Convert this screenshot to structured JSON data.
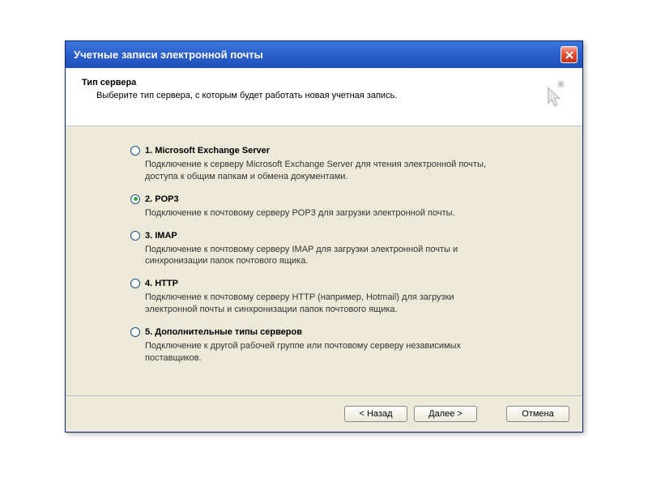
{
  "window": {
    "title": "Учетные записи электронной почты"
  },
  "header": {
    "heading": "Тип сервера",
    "subheading": "Выберите тип сервера, с которым будет работать новая учетная запись."
  },
  "options": [
    {
      "id": "exchange",
      "label": "1. Microsoft Exchange Server",
      "description": "Подключение к серверу Microsoft Exchange Server для чтения электронной почты, доступа к общим папкам и обмена документами.",
      "selected": false
    },
    {
      "id": "pop3",
      "label": "2. POP3",
      "description": "Подключение к почтовому серверу POP3 для загрузки электронной почты.",
      "selected": true
    },
    {
      "id": "imap",
      "label": "3. IMAP",
      "description": "Подключение к почтовому серверу IMAP для загрузки электронной почты и синхронизации папок почтового ящика.",
      "selected": false
    },
    {
      "id": "http",
      "label": "4. HTTP",
      "description": "Подключение к почтовому серверу HTTP (например, Hotmail) для загрузки электронной почты и синхронизации папок почтового ящика.",
      "selected": false
    },
    {
      "id": "other",
      "label": "5. Дополнительные типы серверов",
      "description": "Подключение к другой рабочей группе или почтовому серверу независимых поставщиков.",
      "selected": false
    }
  ],
  "footer": {
    "back": "< Назад",
    "next": "Далее >",
    "cancel": "Отмена"
  }
}
